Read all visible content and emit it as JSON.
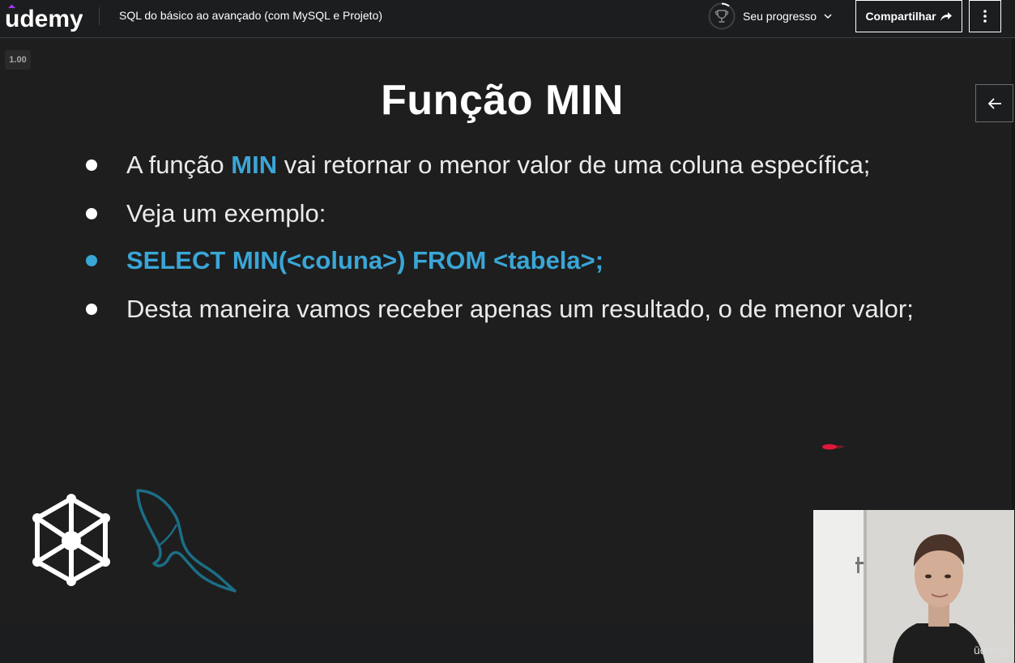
{
  "header": {
    "logo_text": "udemy",
    "course_title": "SQL do básico ao avançado (com MySQL e Projeto)",
    "progress_label": "Seu progresso",
    "share_label": "Compartilhar"
  },
  "player": {
    "speed": "1.00",
    "watermark": "ūdemy"
  },
  "slide": {
    "title": "Função MIN",
    "bullets": [
      {
        "before": "A função ",
        "accent": "MIN",
        "after": " vai retornar o menor valor de uma coluna específica;"
      },
      {
        "text": "Veja um exemplo:"
      },
      {
        "code": "SELECT MIN(<coluna>) FROM <tabela>;"
      },
      {
        "text": "Desta maneira vamos receber apenas um resultado, o de menor valor;"
      }
    ]
  },
  "colors": {
    "background": "#1c1d1f",
    "slide_background": "#1e1e1e",
    "accent": "#3aa6d6",
    "brand": "#a435f0"
  },
  "icons": [
    "udemy-logo",
    "trophy-icon",
    "chevron-down-icon",
    "share-arrow-icon",
    "more-vertical-icon",
    "arrow-left-icon",
    "hex-network-logo",
    "mysql-dolphin-logo"
  ]
}
